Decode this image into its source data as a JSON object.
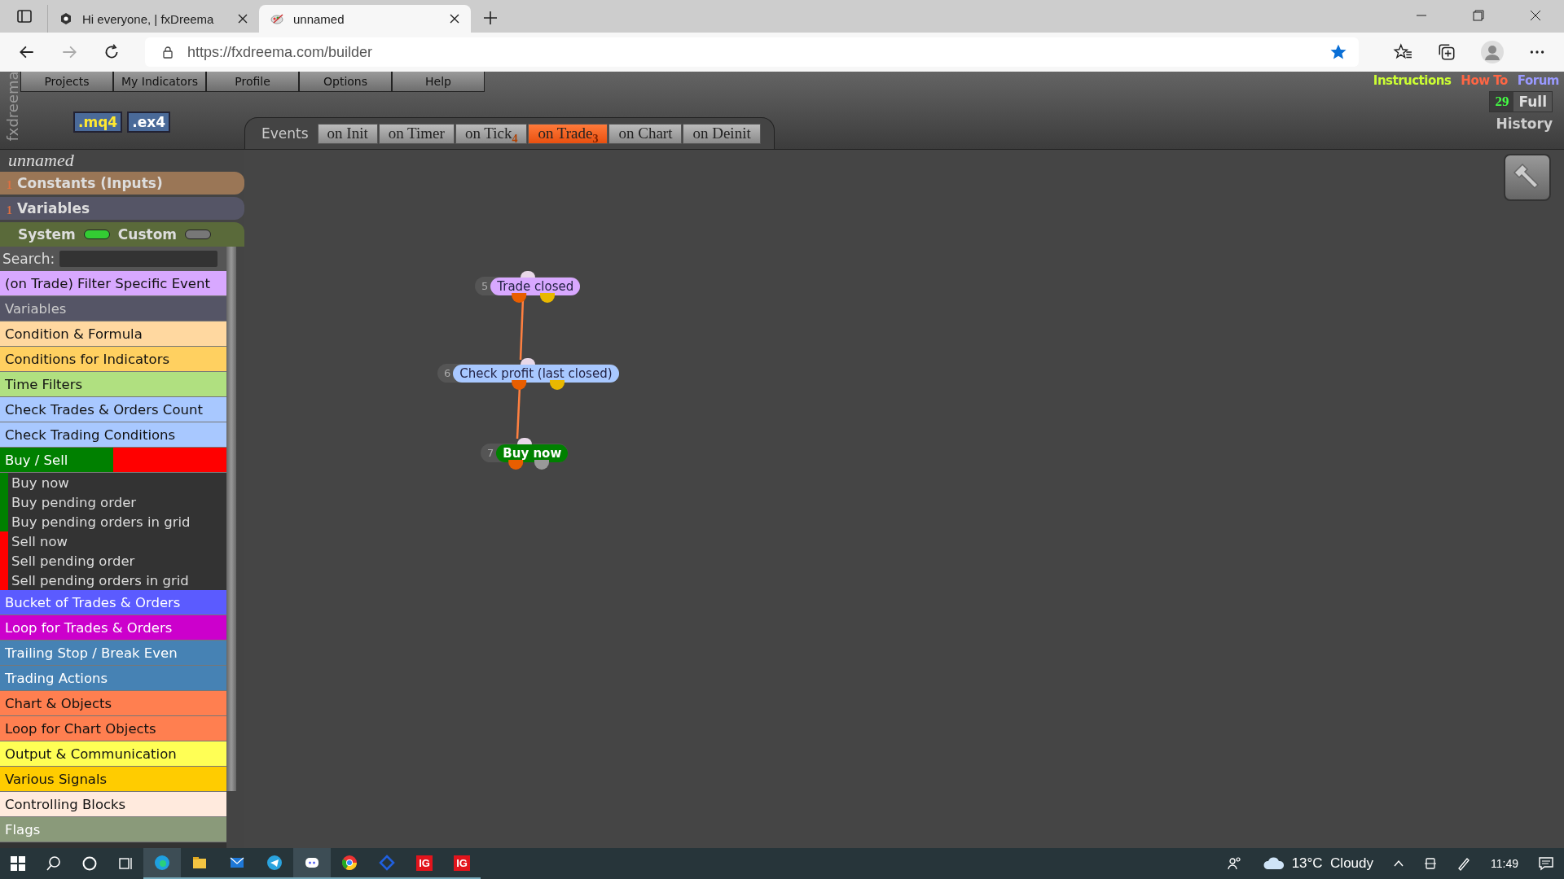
{
  "browser": {
    "tabs": [
      {
        "title": "Hi everyone, | fxDreema",
        "selected": false
      },
      {
        "title": "unnamed",
        "selected": true
      }
    ],
    "url": "https://fxdreema.com/builder"
  },
  "app": {
    "logo": "fxdreema",
    "menu": [
      "Projects",
      "My Indicators",
      "Profile",
      "Options",
      "Help"
    ],
    "export_buttons": [
      ".mq4",
      ".ex4"
    ],
    "links": [
      {
        "label": "Instructions",
        "color": "#ccff33"
      },
      {
        "label": "How To",
        "color": "#ff6644"
      },
      {
        "label": "Forum",
        "color": "#9999ff"
      }
    ],
    "history_count": "29",
    "full_label": "Full",
    "history_label": "History",
    "events_label": "Events",
    "event_tabs": [
      {
        "label": "on Init",
        "selected": false
      },
      {
        "label": "on Timer",
        "selected": false
      },
      {
        "label": "on Tick",
        "count": "4",
        "selected": false
      },
      {
        "label": "on Trade",
        "count": "3",
        "selected": true
      },
      {
        "label": "on Chart",
        "selected": false
      },
      {
        "label": "on Deinit",
        "selected": false
      }
    ],
    "project_name": "unnamed",
    "sections": [
      {
        "count": "1",
        "label": "Constants (Inputs)",
        "color": "#9a7656"
      },
      {
        "count": "1",
        "label": "Variables",
        "color": "#555566"
      }
    ],
    "toggles": [
      {
        "label": "System",
        "on": true
      },
      {
        "label": "Custom",
        "on": false
      }
    ],
    "search_label": "Search:",
    "categories": [
      {
        "label": "(on Trade) Filter Specific Event",
        "color": "#d8a8ff"
      },
      {
        "label": "Variables",
        "color": "#555566"
      },
      {
        "label": "Condition & Formula",
        "color": "#ffd8a0"
      },
      {
        "label": "Conditions for Indicators",
        "color": "#ffd060"
      },
      {
        "label": "Time Filters",
        "color": "#b0e080"
      },
      {
        "label": "Check Trades & Orders Count",
        "color": "#a8c8ff"
      },
      {
        "label": "Check Trading Conditions",
        "color": "#a8c8ff"
      },
      {
        "label": "Buy / Sell",
        "color": "#008000",
        "expanded": true,
        "children": [
          {
            "label": "Buy now",
            "color": "#008000"
          },
          {
            "label": "Buy pending order",
            "color": "#008000"
          },
          {
            "label": "Buy pending orders in grid",
            "color": "#008000"
          },
          {
            "label": "Sell now",
            "color": "#ff0000"
          },
          {
            "label": "Sell pending order",
            "color": "#ff0000"
          },
          {
            "label": "Sell pending orders in grid",
            "color": "#ff0000"
          }
        ]
      },
      {
        "label": "Bucket of Trades & Orders",
        "color": "#5b5bff"
      },
      {
        "label": "Loop for Trades & Orders",
        "color": "#cc00cc"
      },
      {
        "label": "Trailing Stop / Break Even",
        "color": "#4682b4"
      },
      {
        "label": "Trading Actions",
        "color": "#4682b4"
      },
      {
        "label": "Chart & Objects",
        "color": "#ff7f50"
      },
      {
        "label": "Loop for Chart Objects",
        "color": "#ff7f50"
      },
      {
        "label": "Output & Communication",
        "color": "#ffff55"
      },
      {
        "label": "Various Signals",
        "color": "#ffcc00"
      },
      {
        "label": "Controlling Blocks",
        "color": "#ffeadd"
      },
      {
        "label": "Flags",
        "color": "#8a9a7a"
      }
    ],
    "blocks": [
      {
        "number": "5",
        "label": "Trade closed",
        "kind": "filter"
      },
      {
        "number": "6",
        "label": "Check profit (last closed)",
        "kind": "condition"
      },
      {
        "number": "7",
        "label": "Buy now",
        "kind": "buy"
      }
    ]
  },
  "taskbar": {
    "apps": [
      {
        "kind": "edge",
        "selected": true
      },
      {
        "kind": "explorer",
        "selected": false
      },
      {
        "kind": "mail",
        "selected": false
      },
      {
        "kind": "telegram",
        "selected": false
      },
      {
        "kind": "discord",
        "selected": true
      },
      {
        "kind": "chrome",
        "selected": false
      },
      {
        "kind": "diamond",
        "selected": false
      },
      {
        "kind": "ig",
        "label": "IG",
        "selected": false
      },
      {
        "kind": "ig",
        "label": "IG",
        "selected": false
      }
    ],
    "weather": "13°C  Cloudy",
    "time": "11:49"
  }
}
